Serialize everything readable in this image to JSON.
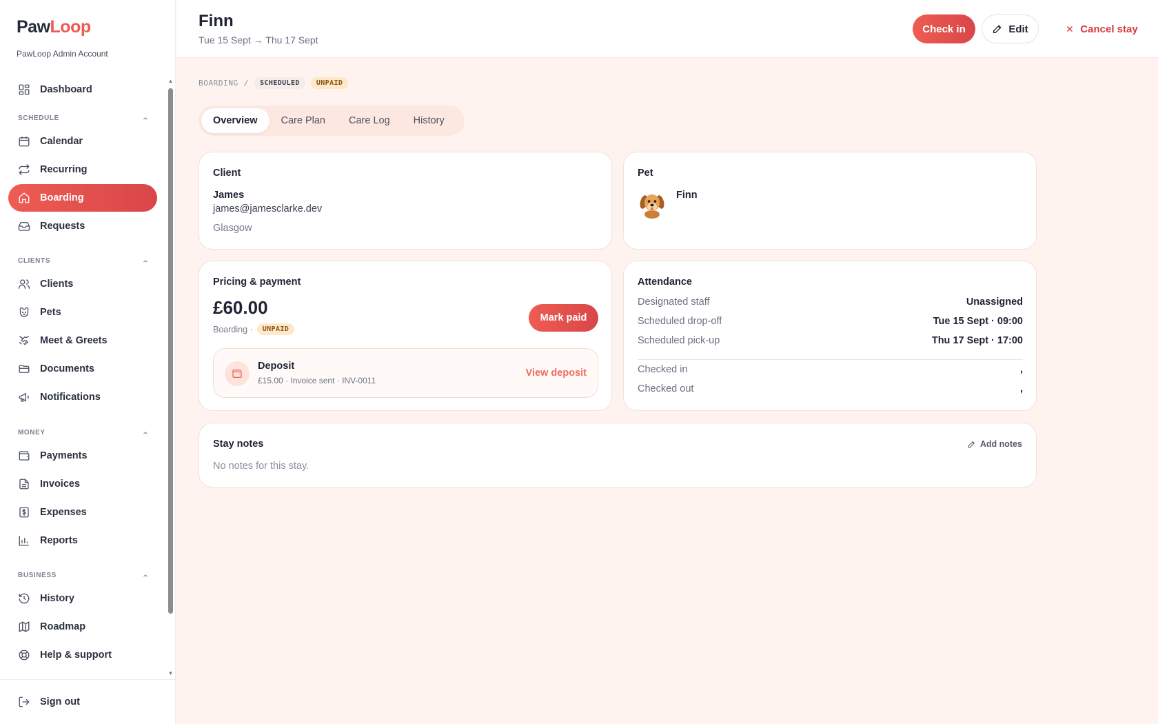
{
  "brand": {
    "name_part1": "Paw",
    "name_part2": "Loop",
    "account": "PawLoop Admin Account"
  },
  "sidebar": {
    "items": [
      {
        "label": "Dashboard",
        "icon": "dashboard-icon"
      },
      {
        "label": "Calendar",
        "icon": "calendar-icon"
      },
      {
        "label": "Recurring",
        "icon": "repeat-icon"
      },
      {
        "label": "Boarding",
        "icon": "home-icon",
        "active": true
      },
      {
        "label": "Requests",
        "icon": "inbox-icon"
      },
      {
        "label": "Clients",
        "icon": "users-icon"
      },
      {
        "label": "Pets",
        "icon": "paw-icon"
      },
      {
        "label": "Meet & Greets",
        "icon": "handshake-icon"
      },
      {
        "label": "Documents",
        "icon": "folder-icon"
      },
      {
        "label": "Notifications",
        "icon": "megaphone-icon"
      },
      {
        "label": "Payments",
        "icon": "wallet-icon"
      },
      {
        "label": "Invoices",
        "icon": "file-icon"
      },
      {
        "label": "Expenses",
        "icon": "dollar-doc-icon"
      },
      {
        "label": "Reports",
        "icon": "bar-chart-icon"
      },
      {
        "label": "History",
        "icon": "history-icon"
      },
      {
        "label": "Roadmap",
        "icon": "map-icon"
      },
      {
        "label": "Help & support",
        "icon": "lifebuoy-icon"
      }
    ],
    "sections": {
      "schedule": "SCHEDULE",
      "clients": "CLIENTS",
      "money": "MONEY",
      "business": "BUSINESS"
    },
    "signout": "Sign out"
  },
  "header": {
    "title": "Finn",
    "dates": "Tue 15 Sept → Thu 17 Sept",
    "checkin": "Check in",
    "edit": "Edit",
    "cancel": "Cancel stay"
  },
  "breadcrumb": {
    "section": "BOARDING",
    "sep": "/",
    "status": "SCHEDULED",
    "payment": "UNPAID"
  },
  "tabs": [
    "Overview",
    "Care Plan",
    "Care Log",
    "History"
  ],
  "client": {
    "title": "Client",
    "name": "James",
    "email": "james@jamesclarke.dev",
    "city": "Glasgow"
  },
  "pet": {
    "title": "Pet",
    "name": "Finn"
  },
  "pricing": {
    "title": "Pricing & payment",
    "amount": "£60.00",
    "type": "Boarding ·",
    "status": "UNPAID",
    "mark_paid": "Mark paid",
    "deposit_title": "Deposit",
    "deposit_meta": "£15.00 · Invoice sent · INV-0011",
    "deposit_link": "View deposit"
  },
  "attendance": {
    "title": "Attendance",
    "rows": [
      {
        "label": "Designated staff",
        "value": "Unassigned"
      },
      {
        "label": "Scheduled drop-off",
        "value": "Tue 15 Sept · 09:00"
      },
      {
        "label": "Scheduled pick-up",
        "value": "Thu 17 Sept · 17:00"
      },
      {
        "label": "Checked in",
        "value": ","
      },
      {
        "label": "Checked out",
        "value": ","
      }
    ]
  },
  "notes": {
    "title": "Stay notes",
    "add": "Add notes",
    "empty": "No notes for this stay."
  },
  "colors": {
    "accent": "#ee5c53",
    "accent_dark": "#d8464a",
    "bg": "#fff3ef",
    "unpaid_bg": "#fde9c9",
    "cancel": "#d63b3b"
  }
}
